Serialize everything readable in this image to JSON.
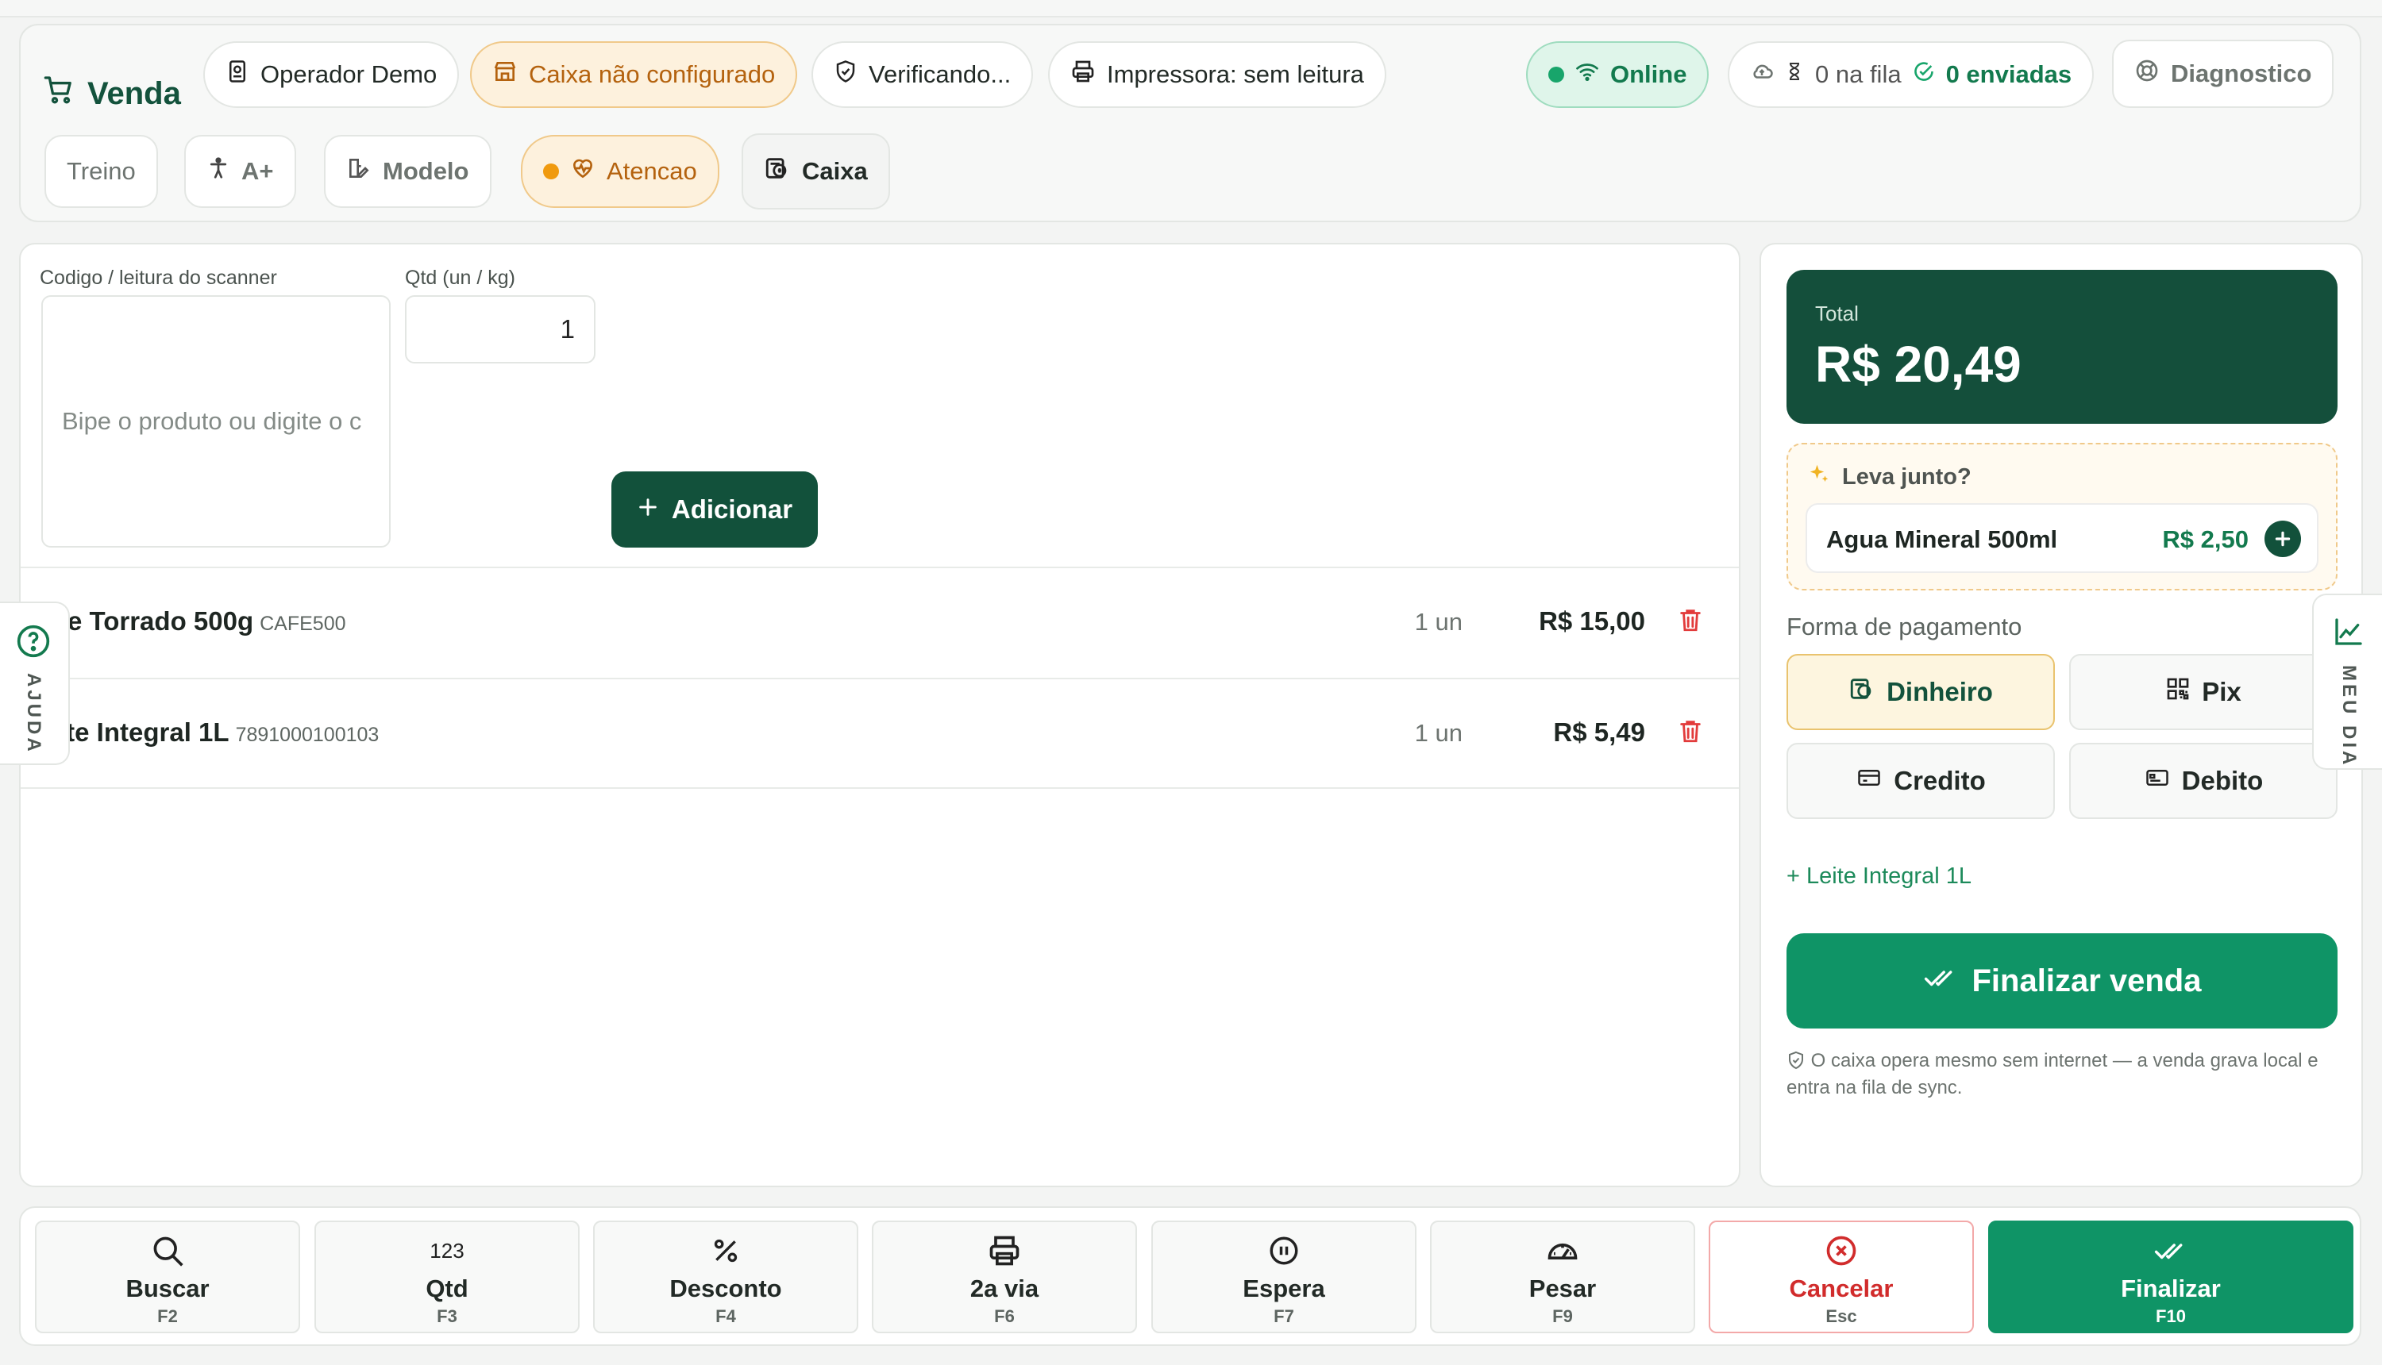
{
  "header": {
    "brand": "Venda",
    "operator": "Operador Demo",
    "register_status": "Caixa não configurado",
    "verify_status": "Verificando...",
    "printer_status": "Impressora: sem leitura",
    "network_status": "Online",
    "queue_count": "0 na fila",
    "sent_count": "0 enviadas",
    "diagnostics": "Diagnostico",
    "training": "Treino",
    "accessibility": "A+",
    "model": "Modelo",
    "attention": "Atencao",
    "register": "Caixa",
    "colors": {
      "brand": "#13523c",
      "warning": "#b4620e",
      "online": "#137a4e"
    }
  },
  "entry": {
    "scan_label": "Codigo / leitura do scanner",
    "scan_placeholder": "Bipe o produto ou digite o c",
    "qty_label": "Qtd (un / kg)",
    "qty_value": "1",
    "add_button": "Adicionar"
  },
  "cart": {
    "items": [
      {
        "name": "fe Torrado 500g",
        "code": "CAFE500",
        "qty": "1 un",
        "price": "R$ 15,00"
      },
      {
        "name": "ite Integral 1L",
        "code": "7891000100103",
        "qty": "1 un",
        "price": "R$ 5,49"
      }
    ]
  },
  "summary": {
    "total_label": "Total",
    "total_value": "R$ 20,49",
    "upsell_title": "Leva junto?",
    "upsell_item": "Agua Mineral 500ml",
    "upsell_price": "R$ 2,50",
    "payment_label": "Forma de pagamento",
    "payments": [
      "Dinheiro",
      "Pix",
      "Credito",
      "Debito"
    ],
    "selected_payment": "Dinheiro",
    "recent_add": "+ Leite Integral 1L",
    "finish_button": "Finalizar venda",
    "offline_note": "O caixa opera mesmo sem internet — a venda grava local e entra na fila de sync."
  },
  "side_tabs": {
    "help": "AJUDA",
    "my_day": "MEU DIA"
  },
  "shortcuts": [
    {
      "label": "Buscar",
      "key": "F2",
      "icon": "search-icon"
    },
    {
      "label": "Qtd",
      "key": "F3",
      "icon": "123"
    },
    {
      "label": "Desconto",
      "key": "F4",
      "icon": "percent-icon"
    },
    {
      "label": "2a via",
      "key": "F6",
      "icon": "printer-icon"
    },
    {
      "label": "Espera",
      "key": "F7",
      "icon": "pause-icon"
    },
    {
      "label": "Pesar",
      "key": "F9",
      "icon": "gauge-icon"
    },
    {
      "label": "Cancelar",
      "key": "Esc",
      "icon": "cancel-icon"
    },
    {
      "label": "Finalizar",
      "key": "F10",
      "icon": "check-double-icon"
    }
  ]
}
